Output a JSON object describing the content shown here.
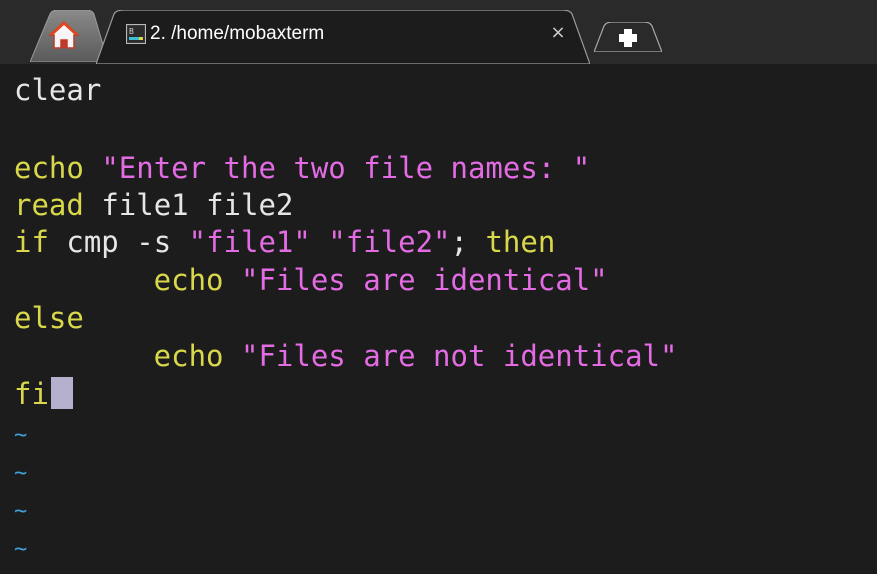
{
  "tabs": {
    "home_icon": "home-icon",
    "active_tab": {
      "icon": "terminal-icon",
      "title": "2. /home/mobaxterm",
      "close_glyph": "×"
    },
    "new_tab_icon": "plus-icon"
  },
  "terminal": {
    "lines": [
      {
        "parts": [
          {
            "text": "clear",
            "kind": "txt"
          }
        ]
      },
      {
        "parts": []
      },
      {
        "parts": [
          {
            "text": "echo ",
            "kind": "kw"
          },
          {
            "text": "\"Enter the two file names: \"",
            "kind": "str"
          }
        ]
      },
      {
        "parts": [
          {
            "text": "read ",
            "kind": "kw"
          },
          {
            "text": "file1 file2",
            "kind": "txt"
          }
        ]
      },
      {
        "parts": [
          {
            "text": "if ",
            "kind": "kw"
          },
          {
            "text": "cmp -s ",
            "kind": "txt"
          },
          {
            "text": "\"file1\" \"file2\"",
            "kind": "str"
          },
          {
            "text": "; ",
            "kind": "txt"
          },
          {
            "text": "then",
            "kind": "kw"
          }
        ]
      },
      {
        "parts": [
          {
            "text": "        echo ",
            "kind": "kw"
          },
          {
            "text": "\"Files are identical\"",
            "kind": "str"
          }
        ]
      },
      {
        "parts": [
          {
            "text": "else",
            "kind": "kw"
          }
        ]
      },
      {
        "parts": [
          {
            "text": "        echo ",
            "kind": "kw"
          },
          {
            "text": "\"Files are not identical\"",
            "kind": "str"
          }
        ]
      },
      {
        "parts": [
          {
            "text": "fi",
            "kind": "kw"
          }
        ],
        "cursor": true
      },
      {
        "parts": [
          {
            "text": "~",
            "kind": "tilde"
          }
        ]
      },
      {
        "parts": [
          {
            "text": "~",
            "kind": "tilde"
          }
        ]
      },
      {
        "parts": [
          {
            "text": "~",
            "kind": "tilde"
          }
        ]
      },
      {
        "parts": [
          {
            "text": "~",
            "kind": "tilde"
          }
        ]
      }
    ]
  },
  "colors": {
    "keyword": "#d8d84a",
    "string": "#e36be3",
    "text": "#e6e6e6",
    "tilde": "#3f9fd8",
    "cursor": "#b6b0cf",
    "background": "#1c1c1c"
  }
}
